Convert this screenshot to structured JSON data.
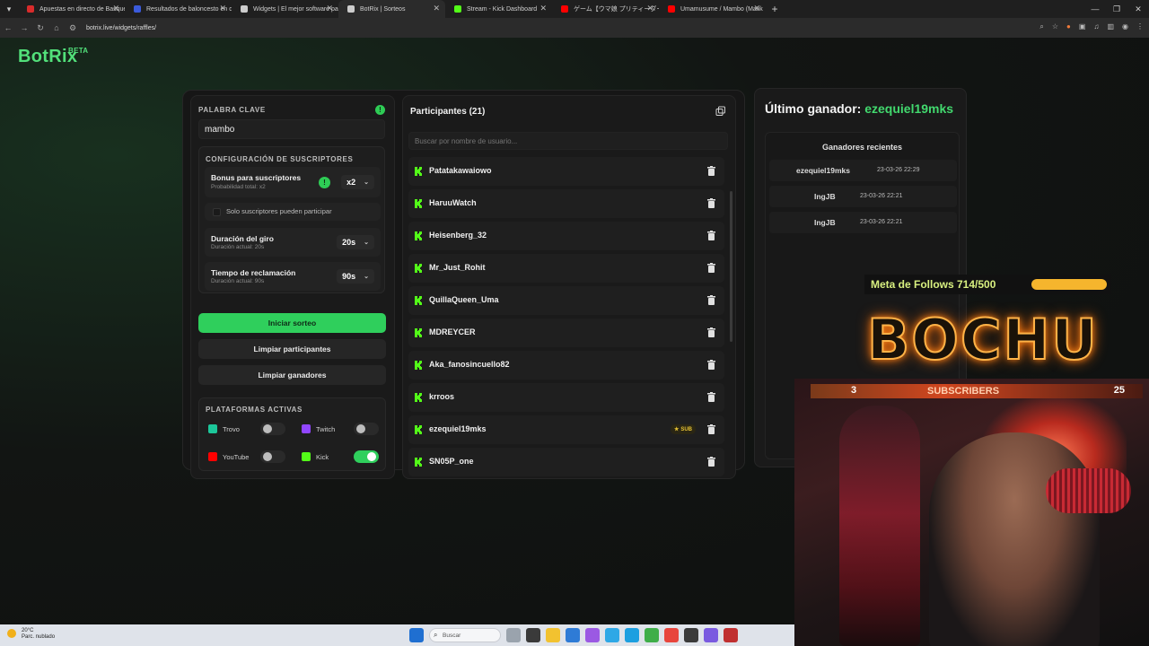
{
  "browser": {
    "tabs": [
      {
        "title": "Apuestas en directo de Basque",
        "color": "#d92b2b"
      },
      {
        "title": "Resultados de baloncesto en d",
        "color": "#3b5bdb"
      },
      {
        "title": "Widgets | El mejor software pa",
        "color": "#cccccc"
      },
      {
        "title": "BotRix | Sorteos",
        "color": "#cccccc"
      },
      {
        "title": "Stream - Kick Dashboard",
        "color": "#53fc18"
      },
      {
        "title": "ゲーム【ウマ娘 プリティーダービ",
        "color": "#ff0000"
      },
      {
        "title": "Umamusume / Mambo (Matik",
        "color": "#ff0000"
      }
    ],
    "url": "botrix.live/widgets/raffles/"
  },
  "app": {
    "logo": "BotRix",
    "logo_badge": "BETA"
  },
  "raffle": {
    "keyword_label": "PALABRA CLAVE",
    "keyword_value": "mambo",
    "subs_config_title": "CONFIGURACIÓN DE SUSCRIPTORES",
    "bonus_title": "Bonus para suscriptores",
    "bonus_sub": "Probabilidad total: x2",
    "bonus_value": "x2",
    "only_subs_label": "Solo suscriptores pueden participar",
    "spin_title": "Duración del giro",
    "spin_sub": "Duración actual: 20s",
    "spin_value": "20s",
    "claim_title": "Tiempo de reclamación",
    "claim_sub": "Duración actual: 90s",
    "claim_value": "90s",
    "start_button": "Iniciar sorteo",
    "clear_participants": "Limpiar participantes",
    "clear_winners": "Limpiar ganadores",
    "platforms_title": "PLATAFORMAS ACTIVAS",
    "platforms": [
      {
        "name": "Trovo",
        "color": "#1cc79a",
        "enabled": false
      },
      {
        "name": "Twitch",
        "color": "#9146ff",
        "enabled": false
      },
      {
        "name": "YouTube",
        "color": "#ff0000",
        "enabled": false
      },
      {
        "name": "Kick",
        "color": "#53fc18",
        "enabled": true
      }
    ]
  },
  "participants": {
    "title": "Participantes (21)",
    "search_placeholder": "Buscar por nombre de usuario...",
    "sub_badge": "SUB",
    "list": [
      {
        "name": "Patatakawaiowo",
        "sub": false
      },
      {
        "name": "HaruuWatch",
        "sub": false
      },
      {
        "name": "Heisenberg_32",
        "sub": false
      },
      {
        "name": "Mr_Just_Rohit",
        "sub": false
      },
      {
        "name": "QuillaQueen_Uma",
        "sub": false
      },
      {
        "name": "MDREYCER",
        "sub": false
      },
      {
        "name": "Aka_fanosincuello82",
        "sub": false
      },
      {
        "name": "krroos",
        "sub": false
      },
      {
        "name": "ezequiel19mks",
        "sub": true
      },
      {
        "name": "SN05P_one",
        "sub": false
      }
    ]
  },
  "winners": {
    "title_prefix": "Último ganador:",
    "last_winner": "ezequiel19mks",
    "recent_title": "Ganadores recientes",
    "recent": [
      {
        "name": "ezequiel19mks",
        "date": "23-03-26 22:29"
      },
      {
        "name": "IngJB",
        "date": "23-03-26 22:21"
      },
      {
        "name": "IngJB",
        "date": "23-03-26 22:21"
      }
    ]
  },
  "overlay": {
    "follows_text": "Meta de Follows 714/500",
    "follows_progress": 1.0,
    "brand": "BOCHU",
    "sub_goal_current": "3",
    "sub_goal_label": "SUBSCRIBERS",
    "sub_goal_target": "25"
  },
  "taskbar": {
    "temperature": "20°C",
    "weather": "Parc. nublado",
    "search": "Buscar"
  }
}
